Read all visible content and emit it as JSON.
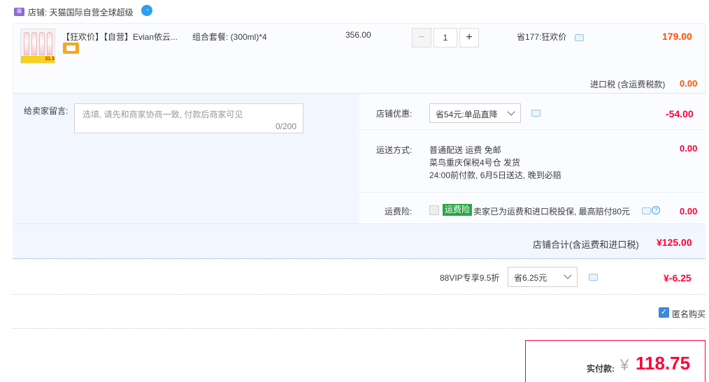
{
  "shop": {
    "name": "店铺: 天猫国际自营全球超级",
    "tmall_icon": "tmall-icon",
    "chat_icon": "wangwang-icon"
  },
  "item": {
    "thumb_price": "31.3",
    "title": "【狂欢价】【自营】Evian依云...",
    "sku": "组合套餐: (300ml)*4",
    "unit_price": "356.00",
    "qty": "1",
    "qty_minus": "−",
    "qty_plus": "+",
    "promo": "省177:狂欢价",
    "total": "179.00",
    "tax_label": "进口税 (含运费税款)",
    "tax_value": "0.00"
  },
  "memo": {
    "label": "给卖家留言:",
    "placeholder": "选填, 请先和商家协商一致, 付款后商家可见",
    "count": "0/200"
  },
  "discount": {
    "label": "店铺优惠:",
    "selected": "省54元:单品直降",
    "value": "-54.00"
  },
  "shipping": {
    "label": "运送方式:",
    "line1": "普通配送 运费 免邮",
    "line2": "菜鸟重庆保税4号仓  发货",
    "line3": "24:00前付款, 6月5日送达, 晚到必赔",
    "value": "0.00"
  },
  "insurance": {
    "label": "运费险:",
    "badge": "运费险",
    "text": "卖家已为运费和进口税投保, 最高赔付80元",
    "help": "?",
    "value": "0.00"
  },
  "shop_total": {
    "label": "店铺合计(含运费和进口税)",
    "value": "¥125.00"
  },
  "vip": {
    "label": "88VIP专享9.5折",
    "selected": "省6.25元",
    "value": "¥-6.25"
  },
  "anonymous": {
    "check": "✓",
    "label": "匿名购买"
  },
  "pay": {
    "label": "实付款:",
    "currency": "¥",
    "value": "118.75"
  },
  "colors": {
    "accent_orange": "#ff5000",
    "accent_red": "#ff0036",
    "checkbox_blue": "#3a89e0",
    "insurance_green": "#28a745"
  }
}
